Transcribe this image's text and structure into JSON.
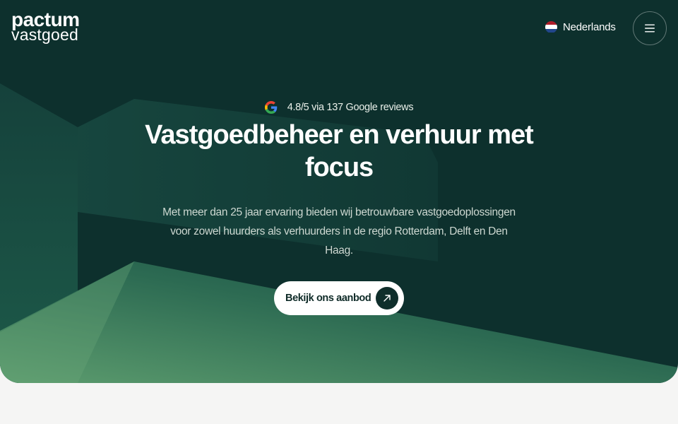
{
  "brand": {
    "line1": "pactum",
    "line2": "vastgoed"
  },
  "header": {
    "language": {
      "label": "Nederlands",
      "flag_colors": [
        "#ae1c28",
        "#ffffff",
        "#21468b"
      ]
    },
    "menu_icon": "hamburger-icon"
  },
  "hero": {
    "reviews": {
      "icon": "google-g-icon",
      "text": "4.8/5 via 137 Google reviews"
    },
    "headline": "Vastgoedbeheer en verhuur met focus",
    "subtext": "Met meer dan 25 jaar ervaring bieden wij betrouwbare vastgoedoplossingen voor zowel huurders als verhuurders in de regio Rotterdam, Delft en Den Haag.",
    "cta": {
      "label": "Bekijk ons aanbod",
      "icon": "arrow-up-right-icon"
    }
  },
  "colors": {
    "hero_bg": "#0d302d",
    "accent_green": "#5a9a6b",
    "page_bg": "#f5f5f4",
    "cta_bg": "#ffffff",
    "cta_icon_bg": "#0f2e2b"
  }
}
